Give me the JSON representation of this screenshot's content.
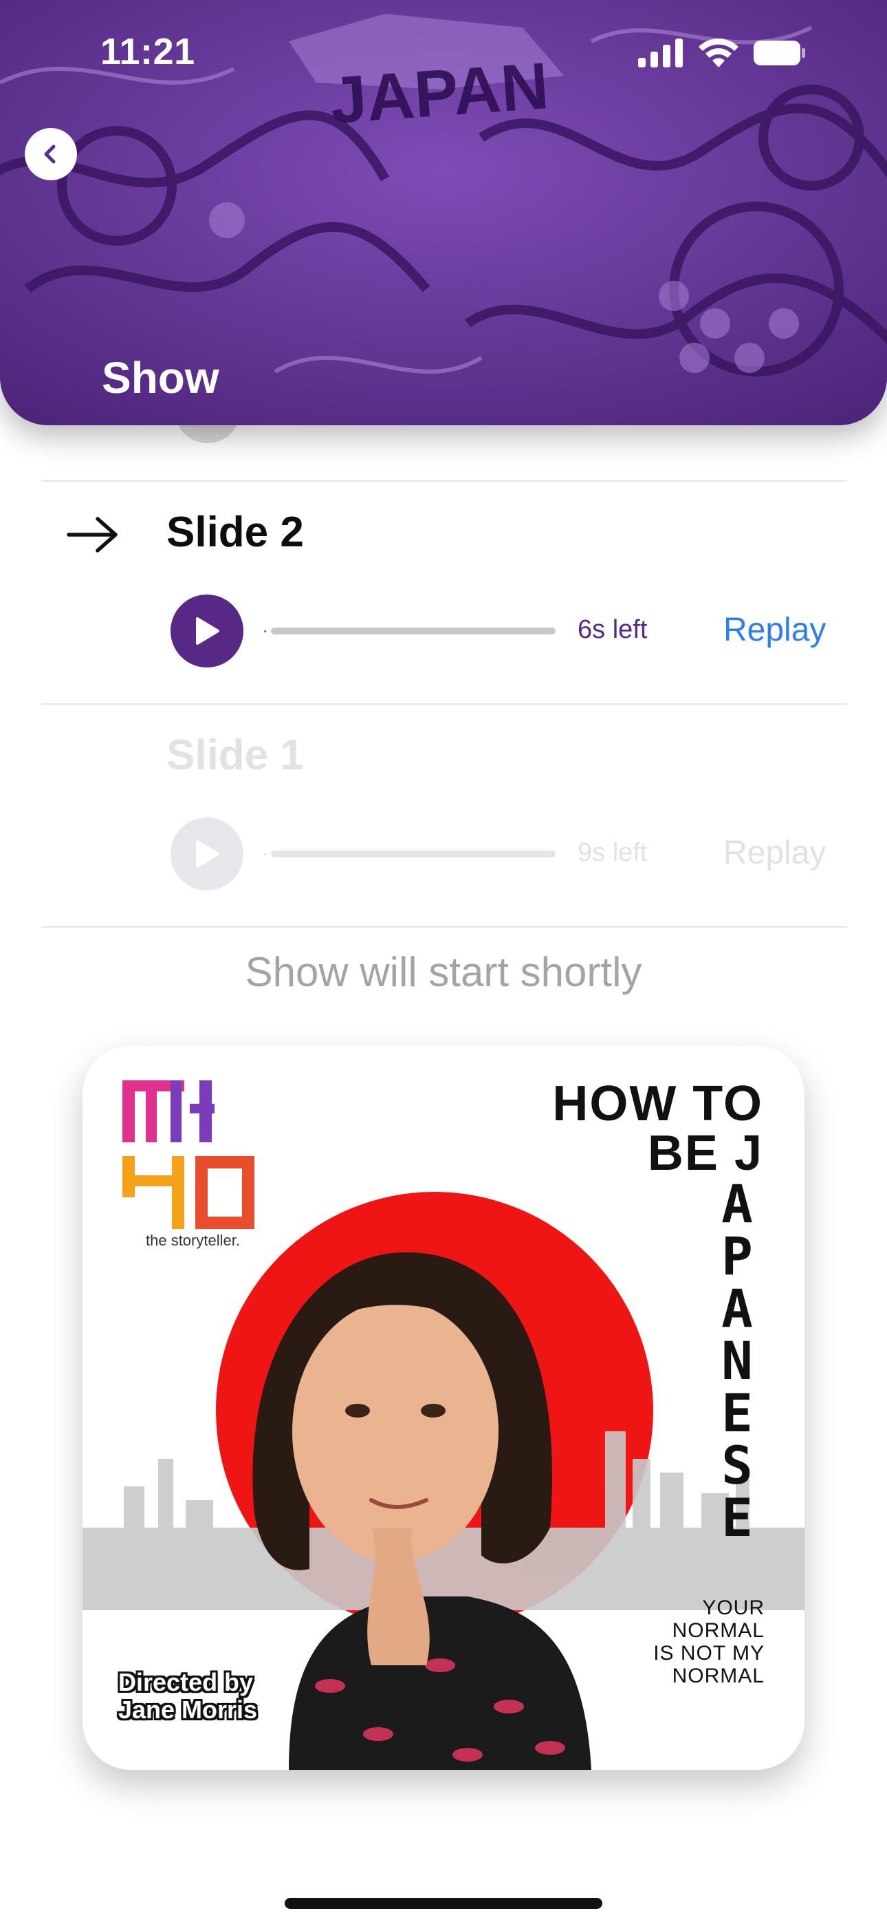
{
  "status_bar": {
    "time": "11:21"
  },
  "header": {
    "title": "Show",
    "background_text": "JAPAN",
    "accent_color": "#6a3a9e"
  },
  "slides": [
    {
      "title": "Slide 2",
      "time_left": "6s left",
      "replay_label": "Replay",
      "state": "playing-next",
      "progress": 0.0
    },
    {
      "title": "Slide 1",
      "time_left": "9s left",
      "replay_label": "Replay",
      "state": "upcoming",
      "progress": 0.0
    }
  ],
  "message": "Show will start shortly",
  "poster": {
    "logo_text": "MI YO",
    "logo_caption": "the storyteller.",
    "title_line1": "HOW TO",
    "title_line2": "BE J",
    "title_vertical": "APANESE",
    "slogan_line1": "YOUR",
    "slogan_line2": "NORMAL",
    "slogan_line3": "IS NOT MY",
    "slogan_line4": "NORMAL",
    "director_line1": "Directed by",
    "director_line2": "Jane Morris"
  },
  "colors": {
    "play_button": "#582887",
    "replay_link": "#2d7ff0",
    "time_left": "#582887",
    "disabled": "#e1e1e6",
    "poster_sun": "#f01515"
  }
}
